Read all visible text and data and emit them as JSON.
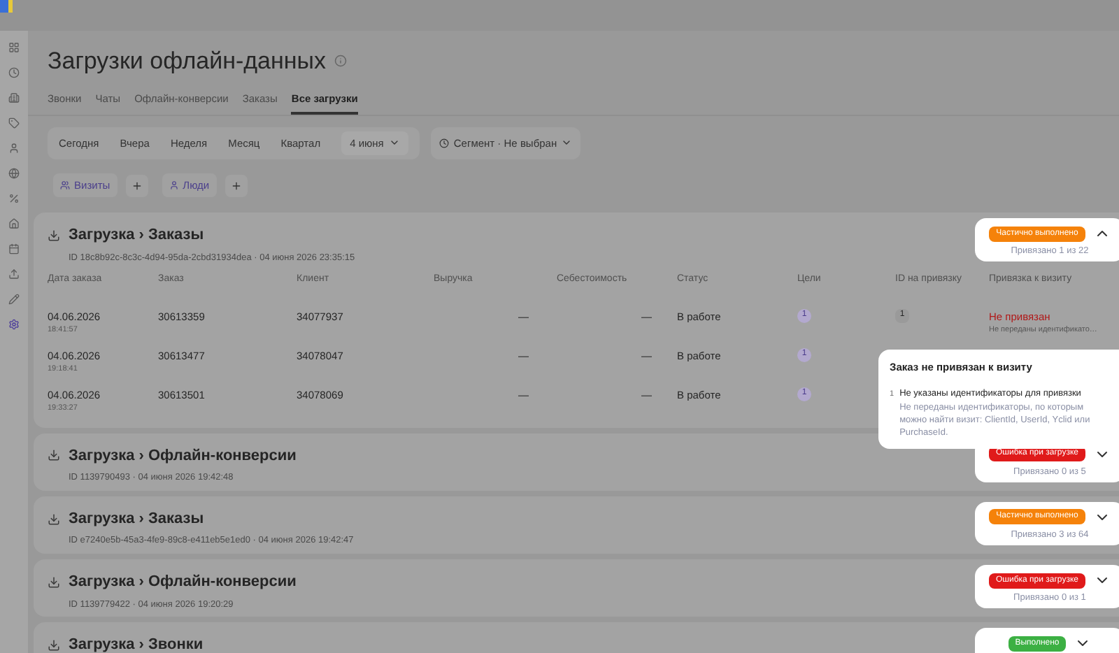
{
  "page": {
    "title": "Загрузки офлайн-данных"
  },
  "tabs": [
    {
      "label": "Звонки",
      "selected": false
    },
    {
      "label": "Чаты",
      "selected": false
    },
    {
      "label": "Офлайн-конверсии",
      "selected": false
    },
    {
      "label": "Заказы",
      "selected": false
    },
    {
      "label": "Все загрузки",
      "selected": true
    }
  ],
  "periods": [
    {
      "label": "Сегодня"
    },
    {
      "label": "Вчера"
    },
    {
      "label": "Неделя"
    },
    {
      "label": "Месяц"
    },
    {
      "label": "Квартал"
    }
  ],
  "date_picker": {
    "value": "4 июня"
  },
  "segment": {
    "value": "Сегмент · Не выбран"
  },
  "chips": [
    {
      "label": "Визиты",
      "kind": "visits"
    },
    {
      "label": "Люди",
      "kind": "people"
    }
  ],
  "uploads": [
    {
      "title": "Загрузка › Заказы",
      "meta": "ID 18c8b92c-8c3c-4d94-95da-2cbd31934dea · 04 июня 2026 23:35:15",
      "status": {
        "label": "Частично выполнено",
        "kind": "partial"
      },
      "linked": "Привязано 1 из 22",
      "expanded": true,
      "table": {
        "columns": [
          "Дата заказа",
          "Заказ",
          "Клиент",
          "Выручка",
          "Себестоимость",
          "Статус",
          "Цели",
          "ID на привязку",
          "Привязка к визиту"
        ],
        "rows": [
          {
            "date": "04.06.2026",
            "time": "18:41:57",
            "order": "30613359",
            "client": "34077937",
            "revenue": "—",
            "cost": "—",
            "status": "В работе",
            "goals": "1",
            "ids": "1",
            "link": {
              "label": "Не привязан",
              "note": "Не переданы идентификато…"
            }
          },
          {
            "date": "04.06.2026",
            "time": "19:18:41",
            "order": "30613477",
            "client": "34078047",
            "revenue": "—",
            "cost": "—",
            "status": "В работе",
            "goals": "1"
          },
          {
            "date": "04.06.2026",
            "time": "19:33:27",
            "order": "30613501",
            "client": "34078069",
            "revenue": "—",
            "cost": "—",
            "status": "В работе",
            "goals": "1"
          }
        ]
      }
    },
    {
      "title": "Загрузка › Офлайн-конверсии",
      "meta": "ID 1139790493 · 04 июня 2026 19:42:48",
      "status": {
        "label": "Ошибка при загрузке",
        "kind": "error"
      },
      "linked": "Привязано 0 из 5",
      "expanded": false
    },
    {
      "title": "Загрузка › Заказы",
      "meta": "ID e7240e5b-45a3-4fe9-89c8-e411eb5e1ed0 · 04 июня 2026 19:42:47",
      "status": {
        "label": "Частично выполнено",
        "kind": "partial"
      },
      "linked": "Привязано 3 из 64",
      "expanded": false
    },
    {
      "title": "Загрузка › Офлайн-конверсии",
      "meta": "ID 1139779422 · 04 июня 2026 19:20:29",
      "status": {
        "label": "Ошибка при загрузке",
        "kind": "error"
      },
      "linked": "Привязано 0 из 1",
      "expanded": false
    },
    {
      "title": "Загрузка › Звонки",
      "status": {
        "label": "Выполнено",
        "kind": "done"
      },
      "expanded": false
    }
  ],
  "tooltip": {
    "title": "Заказ не привязан к визиту",
    "items": [
      {
        "number": "1",
        "title": "Не указаны идентификаторы для привязки",
        "text": "Не переданы идентификаторы, по которым можно найти визит: ClientId, UserId, Yclid или PurchaseId."
      }
    ]
  }
}
